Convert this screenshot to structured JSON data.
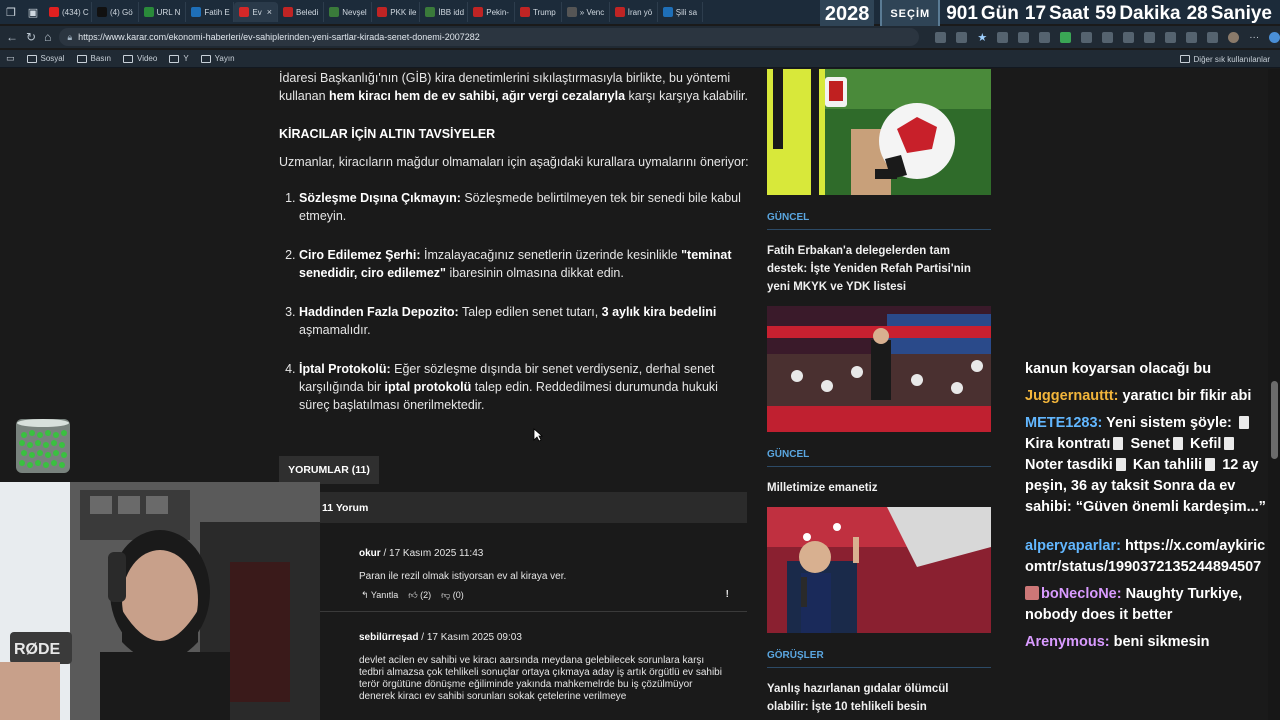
{
  "tabs": [
    {
      "label": "(434) C",
      "color": "#e02020"
    },
    {
      "label": "(4) Gö",
      "color": "#111111"
    },
    {
      "label": "URL N",
      "color": "#2a8a3a"
    },
    {
      "label": "Fatih E",
      "color": "#1e6fb8"
    },
    {
      "label": "Ev",
      "color": "#d42828",
      "active": true
    },
    {
      "label": "Beledi",
      "color": "#c02424"
    },
    {
      "label": "Nevşel",
      "color": "#3a7a3a"
    },
    {
      "label": "PKK ile",
      "color": "#c02424"
    },
    {
      "label": "İBB idd",
      "color": "#3a7a3a"
    },
    {
      "label": "Pekin-",
      "color": "#c02424"
    },
    {
      "label": "Trump",
      "color": "#c02424"
    },
    {
      "label": "» Venc",
      "color": "#555555"
    },
    {
      "label": "İran yö",
      "color": "#c02424"
    },
    {
      "label": "Şili sa",
      "color": "#1e6fb8"
    }
  ],
  "countdown": {
    "year": "2028",
    "badge": "SEÇİM",
    "items": [
      {
        "value": "901",
        "unit": "Gün"
      },
      {
        "value": "17",
        "unit": "Saat"
      },
      {
        "value": "59",
        "unit": "Dakika"
      },
      {
        "value": "28",
        "unit": "Saniye"
      }
    ]
  },
  "address": {
    "url": "https://www.karar.com/ekonomi-haberleri/ev-sahiplerinden-yeni-sartlar-kirada-senet-donemi-2007282"
  },
  "bookmarks": {
    "items": [
      "Sosyal",
      "Basın",
      "Video",
      "Y",
      "Yayın"
    ],
    "other": "Diğer sık kullanılanlar"
  },
  "article": {
    "intro_a": "İdaresi Başkanlığı'nın (GİB) kira denetimlerini sıkılaştırmasıyla birlikte, bu yöntemi kullanan ",
    "intro_bold": "hem kiracı hem de ev sahibi, ağır vergi cezalarıyla",
    "intro_b": " karşı karşıya kalabilir.",
    "heading": "KİRACILAR İÇİN ALTIN TAVSİYELER",
    "lead": "Uzmanlar, kiracıların mağdur olmamaları için aşağıdaki kurallara uymalarını öneriyor:",
    "tips": [
      {
        "title": "Sözleşme Dışına Çıkmayın:",
        "text": " Sözleşmede belirtilmeyen tek bir senedi bile kabul etmeyin.",
        "bold2": "",
        "text2": ""
      },
      {
        "title": "Ciro Edilemez Şerhi:",
        "text": " İmzalayacağınız senetlerin üzerinde kesinlikle ",
        "bold2": "\"teminat senedidir, ciro edilemez\"",
        "text2": " ibaresinin olmasına dikkat edin."
      },
      {
        "title": "Haddinden Fazla Depozito:",
        "text": " Talep edilen senet tutarı, ",
        "bold2": "3 aylık kira bedelini",
        "text2": " aşmamalıdır."
      },
      {
        "title": "İptal Protokolü:",
        "text": " Eğer sözleşme dışında bir senet verdiyseniz, derhal senet karşılığında bir ",
        "bold2": "iptal protokolü",
        "text2": " talep edin. Reddedilmesi durumunda hukuki süreç başlatılması önerilmektedir."
      }
    ]
  },
  "comments": {
    "tab_label": "YORUMLAR (11)",
    "count_label": "11 Yorum",
    "items": [
      {
        "author": "okur",
        "date": " / 17 Kasım 2025 11:43",
        "text": "Paran ile rezil olmak istiyorsan ev al kiraya ver.",
        "reply": "Yanıtla",
        "likes": "(2)",
        "dislikes": "(0)"
      },
      {
        "author": "sebilürreşad",
        "date": " / 17 Kasım 2025 09:03",
        "text": "devlet acilen ev sahibi ve kiracı aarsında meydana gelebilecek sorunlara karşı tedbri almazsa çok tehlikeli sonuçlar ortaya çıkmaya aday iş artık örgütlü ev sahibi terör örgütüne dönüşme eğiliminde yakında mahkemelrde bu iş çözülmüyor denerek kiracı ev sahibi sorunları sokak çetelerine verilmeye"
      }
    ]
  },
  "sidebar": {
    "items": [
      {
        "category": "GÜNCEL",
        "title": "Fatih Erbakan'a delegelerden tam destek: İşte Yeniden Refah Partisi'nin yeni MKYK ve YDK listesi"
      },
      {
        "category": "GÜNCEL",
        "title": "Milletimize emanetiz"
      },
      {
        "category": "GÖRÜŞLER",
        "title": "Yanlış hazırlanan gıdalar ölümcül olabilir: İşte 10 tehlikeli besin"
      }
    ]
  },
  "chat": {
    "messages": [
      {
        "user": "",
        "text": "kanun koyarsan olacağı bu",
        "color": "w"
      },
      {
        "user": "Juggernauttt:",
        "text": " yaratıcı bir fikir abi",
        "color": "y"
      },
      {
        "user": "METE1283:",
        "text": " Yeni sistem şöyle: ",
        "color": "b",
        "docs": true,
        "parts": [
          "Kira kontratı",
          "Senet",
          "Kefil",
          "Noter tasdiki",
          "Kan tahlili",
          "12 ay peşin, 36 ay taksit Sonra da ev sahibi: “Güven önemli kardeşim...”"
        ]
      },
      {
        "user": "alperyaparlar:",
        "text": " https://x.com/aykiricomtr/status/1990372135244894507",
        "color": "b"
      },
      {
        "user": "boNecloNe:",
        "text": " Naughty Turkiye, nobody does it better",
        "color": "p"
      },
      {
        "user": "Arenymous:",
        "text": " beni sikmesin",
        "color": "p"
      }
    ]
  },
  "colors": {
    "accent": "#5aa6e0",
    "chat_yellow": "#f2b53b",
    "chat_blue": "#62b7ff",
    "chat_pink": "#d99bff"
  }
}
